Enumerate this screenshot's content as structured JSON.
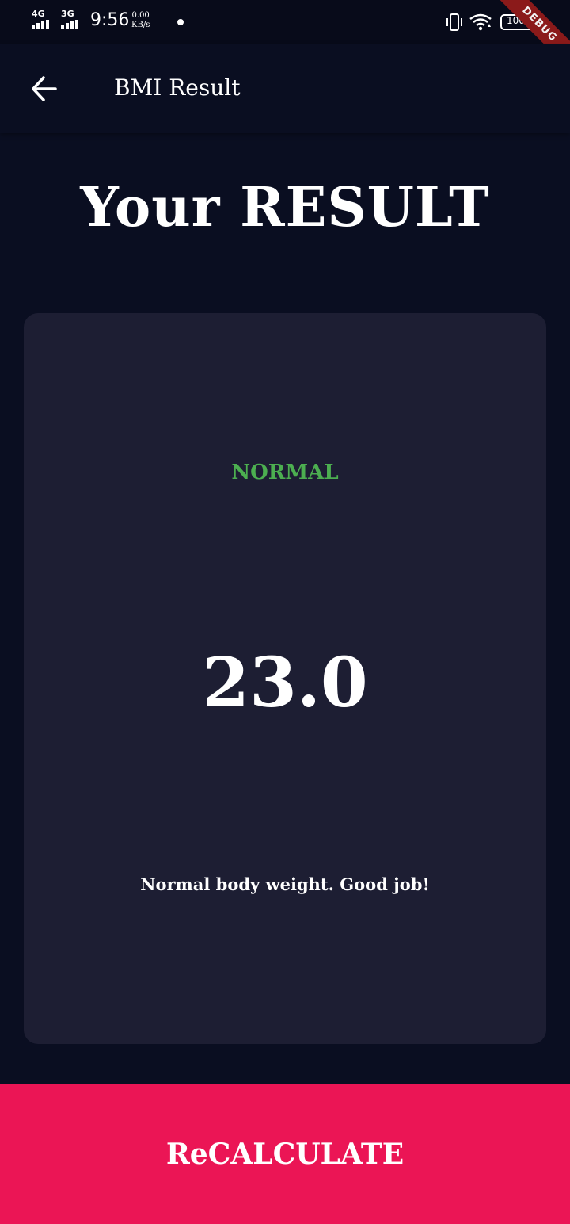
{
  "status_bar": {
    "network_1": "4G",
    "network_2": "3G",
    "time": "9:56",
    "speed_value": "0.00",
    "speed_unit": "KB/s",
    "battery": "100",
    "debug_label": "DEBUG",
    "icons": [
      "signal-icon",
      "vibrate-icon",
      "wifi-icon",
      "battery-icon"
    ]
  },
  "app_bar": {
    "back_icon": "arrow-left-icon",
    "title": "BMI Result"
  },
  "heading": "Your RESULT",
  "result": {
    "status": "NORMAL",
    "value": "23.0",
    "message": "Normal body weight. Good job!"
  },
  "button": {
    "label": "ReCALCULATE"
  },
  "colors": {
    "background": "#0a0e21",
    "card": "#1d1e33",
    "status_normal": "#4caf50",
    "accent": "#eb1555",
    "debug_banner": "#8b1a1a"
  }
}
